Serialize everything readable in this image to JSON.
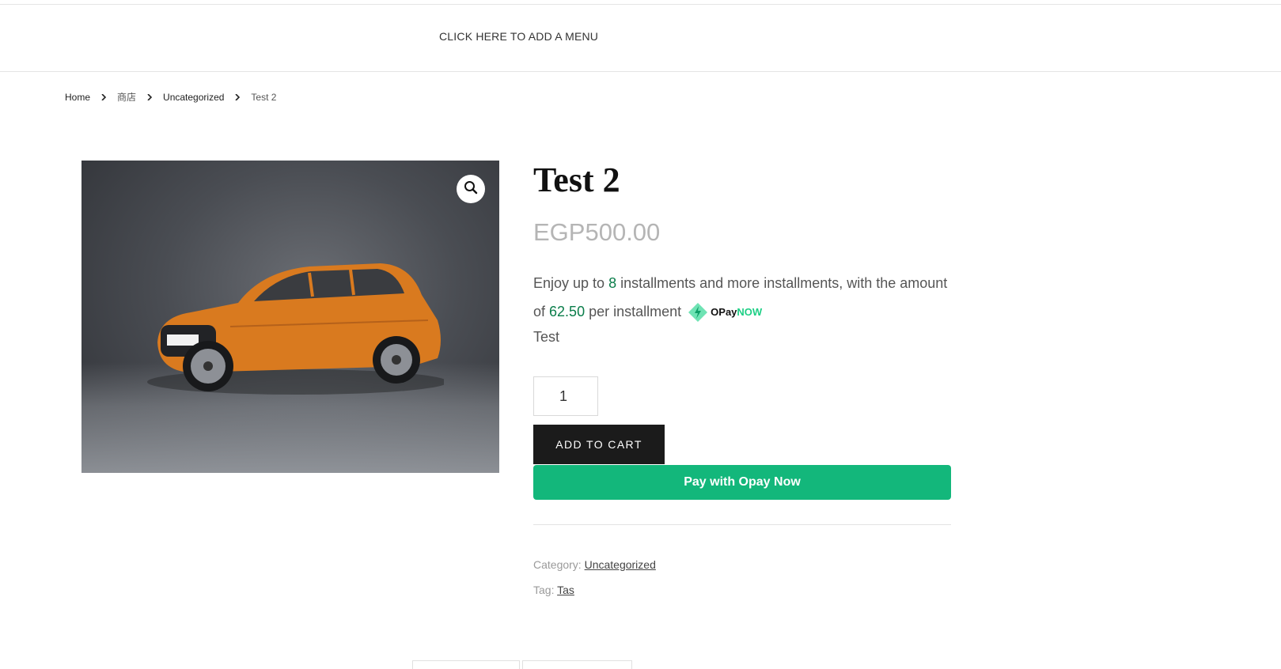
{
  "header": {
    "menu_label": "CLICK HERE TO ADD A MENU"
  },
  "breadcrumb": {
    "items": [
      "Home",
      "商店",
      "Uncategorized"
    ],
    "current": "Test 2"
  },
  "product": {
    "title": "Test 2",
    "price": "EGP500.00",
    "installments": {
      "text_before": "Enjoy up to",
      "count": "8",
      "text_middle": "installments and more installments, with the amount of",
      "amount": "62.50",
      "text_after": "per installment",
      "logo_text": "OPay",
      "logo_text_accent": "NOW"
    },
    "description": "Test",
    "quantity": "1",
    "add_to_cart_label": "ADD TO CART",
    "pay_button_label": "Pay with Opay Now",
    "category_label": "Category:",
    "category_value": "Uncategorized",
    "tag_label": "Tag:",
    "tag_value": "Tas"
  },
  "colors": {
    "accent_green": "#13b77b",
    "installment_green": "#0a7d4a",
    "car_orange": "#d97a1f"
  },
  "icons": {
    "zoom": "magnifier-icon",
    "breadcrumb_separator": "chevron-right-icon",
    "opay": "opay-logo-icon"
  }
}
